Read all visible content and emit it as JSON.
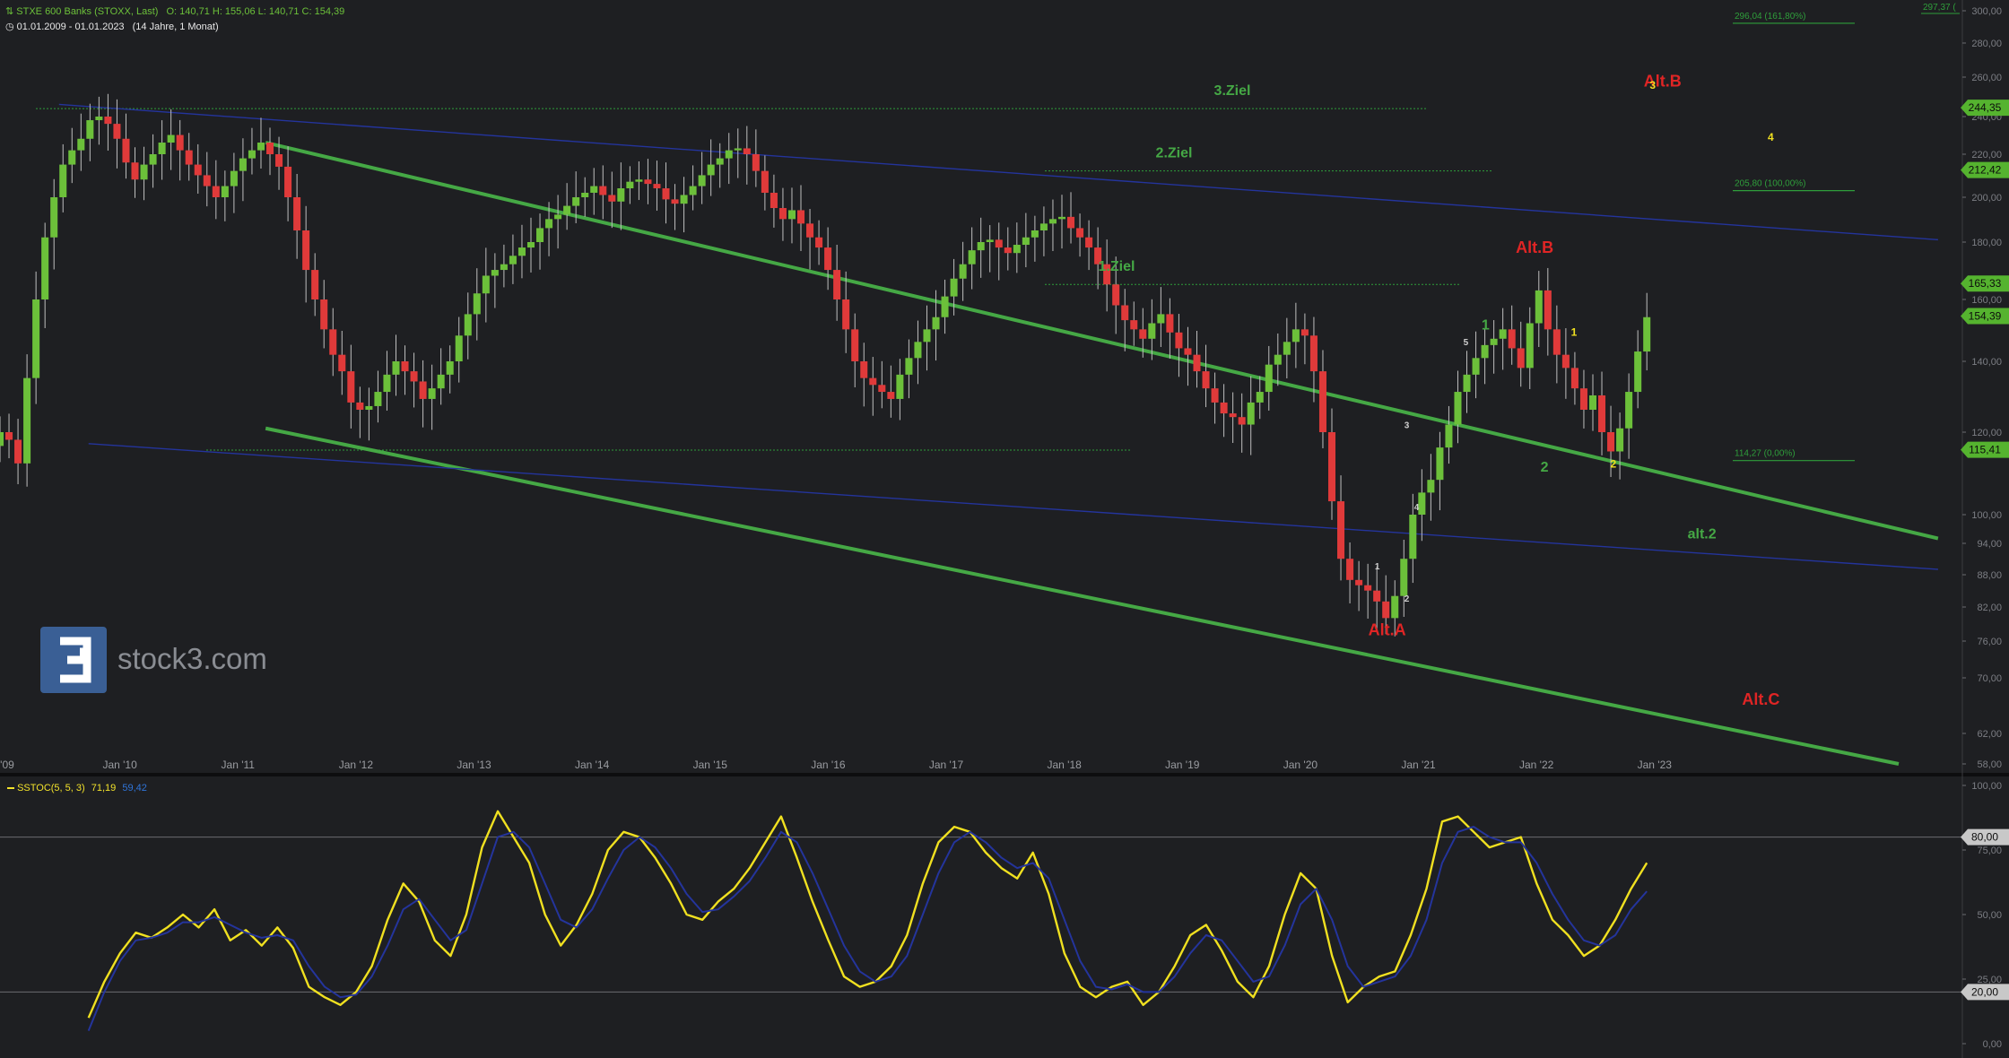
{
  "header": {
    "instrument": "STXE 600 Banks (STOXX, Last)",
    "ohlc": "O: 140,71   H: 155,06   L: 140,71   C: 154,39",
    "period": "01.01.2009 - 01.01.2023",
    "duration": "(14 Jahre, 1 Monat)"
  },
  "watermark": {
    "text": "stock3.com",
    "logo_glyph": "3"
  },
  "indicator": {
    "label": "SSTOC(5, 5, 3)",
    "value_k": "71,19",
    "value_d": "59,42"
  },
  "colors": {
    "background": "#1e1f22",
    "up_candle": "#6cc03a",
    "down_candle": "#e03a3a",
    "trend_green": "#2f9e3b",
    "trend_blue": "#24349c",
    "label_red": "#e02525",
    "label_green": "#45a845",
    "label_yellow": "#f0e020",
    "stoch_k": "#f2e22b",
    "stoch_d": "#2f74d8"
  },
  "chart_data": [
    {
      "type": "candlestick",
      "title": "STXE 600 Banks (STOXX, Last)",
      "x_range": [
        "2009-01",
        "2023-01"
      ],
      "ylim": [
        58,
        300
      ],
      "y_scale": "log",
      "x_ticks": [
        "'09",
        "Jan '10",
        "Jan '11",
        "Jan '12",
        "Jan '13",
        "Jan '14",
        "Jan '15",
        "Jan '16",
        "Jan '17",
        "Jan '18",
        "Jan '19",
        "Jan '20",
        "Jan '21",
        "Jan '22",
        "Jan '23"
      ],
      "y_ticks": [
        "58,00",
        "62,00",
        "70,00",
        "76,00",
        "82,00",
        "88,00",
        "94,00",
        "100,00",
        "120,00",
        "140,00",
        "160,00",
        "180,00",
        "200,00",
        "220,00",
        "240,00",
        "260,00",
        "280,00",
        "300,00"
      ],
      "price_badges": [
        {
          "value": "244,35",
          "color": "green"
        },
        {
          "value": "212,42",
          "color": "green"
        },
        {
          "value": "165,33",
          "color": "green"
        },
        {
          "value": "154,39",
          "color": "green"
        },
        {
          "value": "115,41",
          "color": "green"
        }
      ],
      "fib_levels": [
        {
          "label": "296,04 (161,80%)",
          "value": 296.04
        },
        {
          "label": "205,80 (100,00%)",
          "value": 205.8
        },
        {
          "label": "114,27 (0,00%)",
          "value": 114.27
        }
      ],
      "top_right_value": "297,37 (",
      "target_lines": [
        {
          "label": "3.Ziel",
          "value": 244.35
        },
        {
          "label": "2.Ziel",
          "value": 212.42
        },
        {
          "label": "1.Ziel",
          "value": 165.33
        }
      ],
      "wave_labels": [
        {
          "text": "Alt.B",
          "color": "red",
          "date": "2023-02",
          "value": 255
        },
        {
          "text": "Alt.B",
          "color": "red",
          "date": "2022-01",
          "value": 176
        },
        {
          "text": "Alt.A",
          "color": "red",
          "date": "2020-10",
          "value": 77
        },
        {
          "text": "Alt.C",
          "color": "red",
          "date": "2023-12",
          "value": 66
        },
        {
          "text": "alt.2",
          "color": "green",
          "date": "2023-06",
          "value": 95
        },
        {
          "text": "4",
          "color": "green",
          "date": "2028-09",
          "value": 297
        },
        {
          "text": "1",
          "color": "green",
          "date": "2021-08",
          "value": 150
        },
        {
          "text": "2",
          "color": "green",
          "date": "2022-02",
          "value": 110
        },
        {
          "text": "3",
          "color": "yellow",
          "date": "2023-01",
          "value": 254
        },
        {
          "text": "4",
          "color": "yellow",
          "date": "2024-01",
          "value": 227
        },
        {
          "text": "1",
          "color": "yellow",
          "date": "2022-05",
          "value": 148
        },
        {
          "text": "2",
          "color": "yellow",
          "date": "2022-09",
          "value": 111
        },
        {
          "text": "3",
          "color": "white",
          "date": "2020-12",
          "value": 121
        },
        {
          "text": "4",
          "color": "white",
          "date": "2021-01",
          "value": 101
        },
        {
          "text": "5",
          "color": "white",
          "date": "2021-06",
          "value": 145
        },
        {
          "text": "1",
          "color": "white",
          "date": "2020-09",
          "value": 89
        },
        {
          "text": "2",
          "color": "white",
          "date": "2020-12",
          "value": 83
        }
      ],
      "trendlines": [
        {
          "color": "green",
          "from": {
            "date": "2011-04",
            "value": 226
          },
          "to": {
            "date": "2025-06",
            "value": 95
          }
        },
        {
          "color": "green",
          "from": {
            "date": "2011-04",
            "value": 121
          },
          "to": {
            "date": "2025-02",
            "value": 58
          }
        },
        {
          "color": "blue",
          "from": {
            "date": "2009-07",
            "value": 246
          },
          "to": {
            "date": "2025-06",
            "value": 181
          }
        },
        {
          "color": "blue",
          "from": {
            "date": "2009-10",
            "value": 117
          },
          "to": {
            "date": "2025-06",
            "value": 89
          }
        }
      ],
      "closes": [
        120,
        118,
        112,
        135,
        160,
        182,
        200,
        215,
        222,
        228,
        238,
        240,
        236,
        228,
        216,
        208,
        215,
        220,
        226,
        230,
        222,
        215,
        210,
        205,
        200,
        205,
        212,
        218,
        222,
        226,
        220,
        214,
        200,
        185,
        170,
        160,
        150,
        142,
        137,
        128,
        126,
        127,
        131,
        136,
        140,
        137,
        134,
        129,
        132,
        136,
        140,
        148,
        155,
        162,
        168,
        170,
        172,
        175,
        178,
        180,
        186,
        190,
        192,
        196,
        200,
        202,
        205,
        201,
        198,
        204,
        207,
        208,
        206,
        204,
        199,
        197,
        201,
        205,
        210,
        215,
        218,
        222,
        223,
        220,
        212,
        202,
        195,
        190,
        194,
        188,
        182,
        178,
        170,
        160,
        150,
        140,
        135,
        133,
        131,
        129,
        136,
        141,
        146,
        150,
        154,
        161,
        167,
        172,
        177,
        180,
        181,
        178,
        176,
        179,
        182,
        185,
        188,
        190,
        191,
        186,
        182,
        178,
        172,
        165,
        158,
        153,
        150,
        147,
        152,
        155,
        149,
        144,
        142,
        137,
        132,
        128,
        125,
        124,
        122,
        128,
        131,
        139,
        142,
        146,
        150,
        148,
        137,
        120,
        103,
        91,
        87,
        86,
        85,
        83,
        80,
        84,
        91,
        100,
        105,
        108,
        116,
        122,
        131,
        136,
        141,
        145,
        147,
        150,
        144,
        138,
        152,
        163,
        150,
        142,
        138,
        132,
        126,
        130,
        120,
        115,
        121,
        131,
        143,
        154
      ]
    },
    {
      "type": "line",
      "title": "SSTOC(5, 5, 3)",
      "ylim": [
        0,
        100
      ],
      "y_ticks": [
        "0,00",
        "20,00",
        "25,00",
        "50,00",
        "75,00",
        "80,00",
        "100,00"
      ],
      "reference_lines": [
        80,
        20
      ],
      "series": [
        {
          "name": "71,19",
          "color": "yellow",
          "values": [
            10,
            24,
            35,
            43,
            41,
            45,
            50,
            45,
            52,
            40,
            44,
            38,
            45,
            37,
            22,
            18,
            15,
            20,
            30,
            48,
            62,
            55,
            40,
            34,
            50,
            76,
            90,
            80,
            70,
            50,
            38,
            46,
            58,
            75,
            82,
            80,
            72,
            62,
            50,
            48,
            55,
            60,
            68,
            78,
            88,
            72,
            55,
            40,
            26,
            22,
            24,
            30,
            42,
            62,
            78,
            84,
            82,
            74,
            68,
            64,
            74,
            58,
            35,
            22,
            18,
            22,
            24,
            15,
            20,
            30,
            42,
            46,
            36,
            24,
            18,
            30,
            50,
            66,
            60,
            34,
            16,
            22,
            26,
            28,
            42,
            60,
            86,
            88,
            82,
            76,
            78,
            80,
            62,
            48,
            42,
            34,
            38,
            48,
            60,
            70
          ]
        },
        {
          "name": "59,42",
          "color": "blue",
          "values": [
            5,
            20,
            32,
            40,
            41,
            43,
            47,
            47,
            49,
            46,
            43,
            41,
            42,
            40,
            30,
            22,
            18,
            19,
            26,
            38,
            52,
            56,
            48,
            40,
            44,
            62,
            80,
            82,
            76,
            62,
            48,
            45,
            52,
            64,
            75,
            80,
            76,
            68,
            58,
            51,
            52,
            57,
            63,
            72,
            82,
            78,
            66,
            52,
            38,
            28,
            24,
            26,
            34,
            50,
            66,
            78,
            82,
            78,
            72,
            68,
            70,
            64,
            48,
            32,
            22,
            21,
            23,
            20,
            20,
            26,
            35,
            42,
            40,
            32,
            24,
            26,
            38,
            54,
            60,
            48,
            30,
            22,
            24,
            26,
            34,
            48,
            70,
            82,
            84,
            80,
            78,
            78,
            70,
            58,
            48,
            40,
            38,
            42,
            52,
            59
          ]
        }
      ]
    }
  ]
}
